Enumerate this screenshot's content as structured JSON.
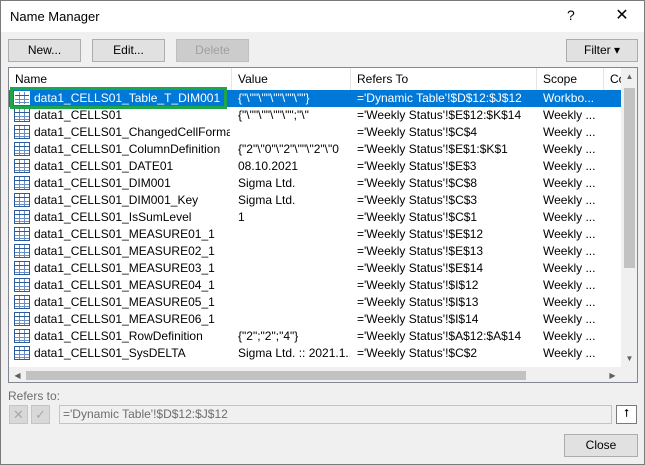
{
  "window": {
    "title": "Name Manager",
    "help": "?",
    "close": "✕"
  },
  "toolbar": {
    "new_label": "New...",
    "edit_label": "Edit...",
    "delete_label": "Delete",
    "filter_label": "Filter ▾"
  },
  "columns": [
    "Name",
    "Value",
    "Refers To",
    "Scope",
    "Co"
  ],
  "rows": [
    {
      "name": "data1_CELLS01_Table_T_DIM001",
      "value": "{\"\\\"\"\\\"\"\\\"\"\\\"\"\\\"\"}",
      "refers": "='Dynamic Table'!$D$12:$J$12",
      "scope": "Workbo..."
    },
    {
      "name": "data1_CELLS01",
      "value": "{\"\\\"\"\\\"\"\\\"\"\\\"\";\"\\\"",
      "refers": "='Weekly Status'!$E$12:$K$14",
      "scope": "Weekly ..."
    },
    {
      "name": "data1_CELLS01_ChangedCellFormat",
      "value": "",
      "refers": "='Weekly Status'!$C$4",
      "scope": "Weekly ..."
    },
    {
      "name": "data1_CELLS01_ColumnDefinition",
      "value": "{\"2\"\\\"0\"\\\"2\"\\\"\"\\\"2\"\\\"0",
      "refers": "='Weekly Status'!$E$1:$K$1",
      "scope": "Weekly ..."
    },
    {
      "name": "data1_CELLS01_DATE01",
      "value": "08.10.2021",
      "refers": "='Weekly Status'!$E$3",
      "scope": "Weekly ..."
    },
    {
      "name": "data1_CELLS01_DIM001",
      "value": "Sigma Ltd.",
      "refers": "='Weekly Status'!$C$8",
      "scope": "Weekly ..."
    },
    {
      "name": "data1_CELLS01_DIM001_Key",
      "value": "Sigma Ltd.",
      "refers": "='Weekly Status'!$C$3",
      "scope": "Weekly ..."
    },
    {
      "name": "data1_CELLS01_IsSumLevel",
      "value": "1",
      "refers": "='Weekly Status'!$C$1",
      "scope": "Weekly ..."
    },
    {
      "name": "data1_CELLS01_MEASURE01_1",
      "value": "",
      "refers": "='Weekly Status'!$E$12",
      "scope": "Weekly ..."
    },
    {
      "name": "data1_CELLS01_MEASURE02_1",
      "value": "",
      "refers": "='Weekly Status'!$E$13",
      "scope": "Weekly ..."
    },
    {
      "name": "data1_CELLS01_MEASURE03_1",
      "value": "",
      "refers": "='Weekly Status'!$E$14",
      "scope": "Weekly ..."
    },
    {
      "name": "data1_CELLS01_MEASURE04_1",
      "value": "",
      "refers": "='Weekly Status'!$I$12",
      "scope": "Weekly ..."
    },
    {
      "name": "data1_CELLS01_MEASURE05_1",
      "value": "",
      "refers": "='Weekly Status'!$I$13",
      "scope": "Weekly ..."
    },
    {
      "name": "data1_CELLS01_MEASURE06_1",
      "value": "",
      "refers": "='Weekly Status'!$I$14",
      "scope": "Weekly ..."
    },
    {
      "name": "data1_CELLS01_RowDefinition",
      "value": "{\"2\";\"2\";\"4\"}",
      "refers": "='Weekly Status'!$A$12:$A$14",
      "scope": "Weekly ..."
    },
    {
      "name": "data1_CELLS01_SysDELTA",
      "value": "Sigma Ltd. :: 2021.1...",
      "refers": "='Weekly Status'!$C$2",
      "scope": "Weekly ..."
    }
  ],
  "selected_row": 0,
  "refers_to": {
    "label": "Refers to:",
    "cancel_icon": "✕",
    "confirm_icon": "✓",
    "value": "='Dynamic Table'!$D$12:$J$12",
    "collapse_icon": "⭡"
  },
  "footer": {
    "close_label": "Close"
  },
  "colors": {
    "selection": "#0078d7",
    "highlight_box": "#1fa64a"
  }
}
